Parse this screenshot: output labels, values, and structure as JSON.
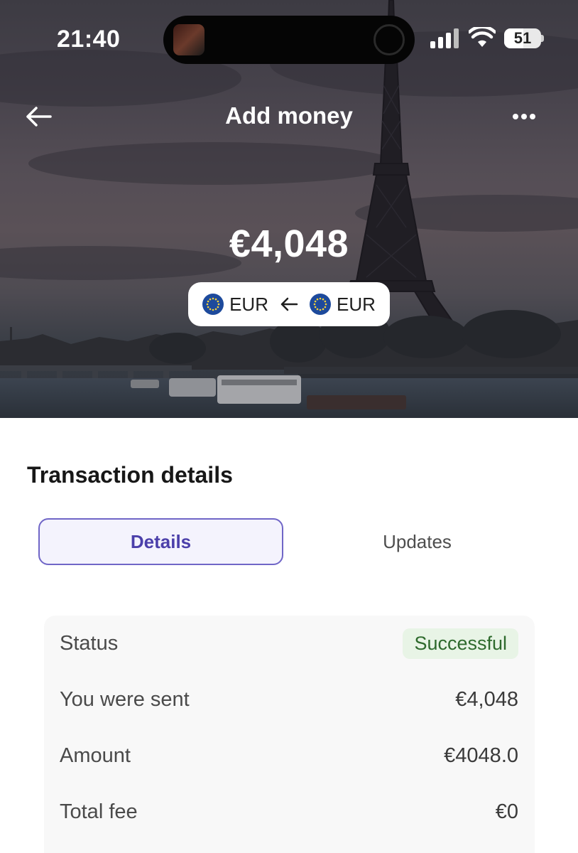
{
  "status_bar": {
    "time": "21:40",
    "battery": "51",
    "battery_level": 0.51,
    "icons": [
      "signal-icon",
      "wifi-icon",
      "battery-icon"
    ]
  },
  "header": {
    "title": "Add money",
    "back_icon": "arrow-left-icon",
    "more_icon": "more-horizontal-icon"
  },
  "hero": {
    "amount": "€4,048",
    "from_currency": "EUR",
    "to_currency": "EUR",
    "flag_icon": "eu-flag-icon"
  },
  "section": {
    "title": "Transaction details"
  },
  "tabs": [
    {
      "label": "Details",
      "active": true
    },
    {
      "label": "Updates",
      "active": false
    }
  ],
  "details": {
    "status_label": "Status",
    "status_value": "Successful",
    "sent_label": "You were sent",
    "sent_value": "€4,048",
    "amount_label": "Amount",
    "amount_value": "€4048.0",
    "fee_label": "Total fee",
    "fee_value": "€0"
  },
  "colors": {
    "accent": "#4b3faa",
    "accent_border": "#7066c7",
    "success_text": "#2e6a2d",
    "success_bg": "#e8f4e6"
  }
}
